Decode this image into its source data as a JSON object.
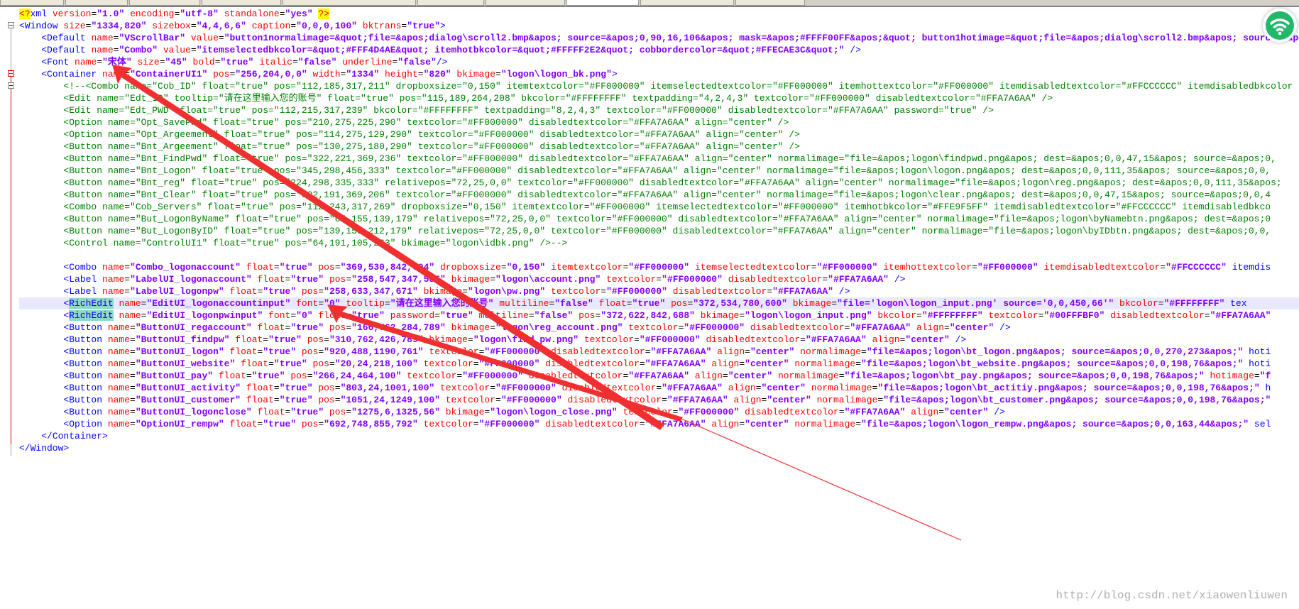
{
  "editor": {
    "language": "xml",
    "highlighted_line": 25,
    "lines": [
      "<?xml version=\"1.0\" encoding=\"utf-8\" standalone=\"yes\" ?>",
      "<Window size=\"1334,820\" sizebox=\"4,4,6,6\" caption=\"0,0,0,100\" bktrans=\"true\">",
      "    <Default name=\"VScrollBar\" value=\"button1normalimage=&quot;file=&apos;dialog\\scroll2.bmp&apos; source=&apos;0,90,16,106&apos; mask=&apos;#FFFF00FF&apos;&quot; button1hotimage=&quot;file=&apos;dialog\\scroll2.bmp&apos; source=&apos;",
      "    <Default name=\"Combo\" value=\"itemselectedbkcolor=&quot;#FFF4D4AE&quot; itemhotbkcolor=&quot;#FFFFF2E2&quot; cobbordercolor=&quot;#FFECAE3C&quot;\" />",
      "    <Font name=\"宋体\" size=\"45\" bold=\"true\" italic=\"false\" underline=\"false\"/>",
      "    <Container name=\"ContainerUI1\" pos=\"256,204,0,0\" width=\"1334\" height=\"820\" bkimage=\"logon\\logon_bk.png\">",
      "        <!--<Combo name=\"Cob_ID\" float=\"true\" pos=\"112,185,317,211\" dropboxsize=\"0,150\" itemtextcolor=\"#FF000000\" itemselectedtextcolor=\"#FF000000\" itemhottextcolor=\"#FF000000\" itemdisabledtextcolor=\"#FFCCCCCC\" itemdisabledbkcolor",
      "        <Edit name=\"Edt_ID\" tooltip=\"请在这里输入您的账号\" float=\"true\" pos=\"115,189,264,208\" bkcolor=\"#FFFFFFFF\" textpadding=\"4,2,4,3\" textcolor=\"#FF000000\" disabledtextcolor=\"#FFA7A6AA\" />",
      "        <Edit name=\"Edt_PWD\" float=\"true\" pos=\"112,215,317,239\" bkcolor=\"#FFFFFFFF\" textpadding=\"8,2,4,3\" textcolor=\"#FF000000\" disabledtextcolor=\"#FFA7A6AA\" password=\"true\" />",
      "        <Option name=\"Opt_SavePwd\" float=\"true\" pos=\"210,275,225,290\" textcolor=\"#FF000000\" disabledtextcolor=\"#FFA7A6AA\" align=\"center\" />",
      "        <Option name=\"Opt_Argeement\" float=\"true\" pos=\"114,275,129,290\" textcolor=\"#FF000000\" disabledtextcolor=\"#FFA7A6AA\" align=\"center\" />",
      "        <Button name=\"Bnt_Argeement\" float=\"true\" pos=\"130,275,180,290\" textcolor=\"#FF000000\" disabledtextcolor=\"#FFA7A6AA\" align=\"center\" />",
      "        <Button name=\"Bnt_FindPwd\" float=\"true\" pos=\"322,221,369,236\" textcolor=\"#FF000000\" disabledtextcolor=\"#FFA7A6AA\" align=\"center\" normalimage=\"file=&apos;logon\\findpwd.png&apos; dest=&apos;0,0,47,15&apos; source=&apos;0,",
      "        <Button name=\"Bnt_Logon\" float=\"true\" pos=\"345,298,456,333\" textcolor=\"#FF000000\" disabledtextcolor=\"#FFA7A6AA\" align=\"center\" normalimage=\"file=&apos;logon\\logon.png&apos; dest=&apos;0,0,111,35&apos; source=&apos;0,0,",
      "        <Button name=\"Bnt_reg\" float=\"true\" pos=\"224,298,335,333\" relativepos=\"72,25,0,0\" textcolor=\"#FF000000\" disabledtextcolor=\"#FFA7A6AA\" align=\"center\" normalimage=\"file=&apos;logon\\reg.png&apos; dest=&apos;0,0,111,35&apos;",
      "        <Button name=\"Bnt_Clear\" float=\"true\" pos=\"322,191,369,206\" textcolor=\"#FF000000\" disabledtextcolor=\"#FFA7A6AA\" align=\"center\" normalimage=\"file=&apos;logon\\clear.png&apos; dest=&apos;0,0,47,15&apos; source=&apos;0,0,4",
      "        <Combo name=\"Cob_Servers\" float=\"true\" pos=\"112,243,317,269\" dropboxsize=\"0,150\" itemtextcolor=\"#FF000000\" itemselectedtextcolor=\"#FF000000\" itemhotbkcolor=\"#FFE9F5FF\" itemdisabledtextcolor=\"#FFCCCCCC\" itemdisabledbkco",
      "        <Button name=\"But_LogonByName\" float=\"true\" pos=\"65,155,139,179\" relativepos=\"72,25,0,0\" textcolor=\"#FF000000\" disabledtextcolor=\"#FFA7A6AA\" align=\"center\" normalimage=\"file=&apos;logon\\byNamebtn.png&apos; dest=&apos;0",
      "        <Button name=\"But_LogonByID\" float=\"true\" pos=\"139,155,212,179\" relativepos=\"72,25,0,0\" textcolor=\"#FF000000\" disabledtextcolor=\"#FFA7A6AA\" align=\"center\" normalimage=\"file=&apos;logon\\byIDbtn.png&apos; dest=&apos;0,0,",
      "        <Control name=\"ControlUI1\" float=\"true\" pos=\"64,191,105,263\" bkimage=\"logon\\idbk.png\" />-->",
      "",
      "        <Combo name=\"Combo_logonaccount\" float=\"true\" pos=\"369,530,842,604\" dropboxsize=\"0,150\" itemtextcolor=\"#FF000000\" itemselectedtextcolor=\"#FF000000\" itemhottextcolor=\"#FF000000\" itemdisabledtextcolor=\"#FFCCCCCC\" itemdis",
      "        <Label name=\"LabelUI_logonaccount\" float=\"true\" pos=\"258,547,347,585\" bkimage=\"logon\\account.png\" textcolor=\"#FF000000\" disabledtextcolor=\"#FFA7A6AA\" />",
      "        <Label name=\"LabelUI_logonpw\" float=\"true\" pos=\"258,633,347,671\" bkimage=\"logon\\pw.png\" textcolor=\"#FF000000\" disabledtextcolor=\"#FFA7A6AA\" />",
      "        <RichEdit name=\"EditUI_logonaccountinput\" font=\"0\" tooltip=\"请在这里输入您的账号\" multiline=\"false\" float=\"true\" pos=\"372,534,780,600\" bkimage=\"file='logon\\logon_input.png' source='0,0,450,66'\" bkcolor=\"#FFFFFFFF\" tex",
      "        <RichEdit name=\"EditUI_logonpwinput\" font=\"0\" float=\"true\" password=\"true\" multiline=\"false\" pos=\"372,622,842,688\" bkimage=\"logon\\logon_input.png\" bkcolor=\"#FFFFFFFF\" textcolor=\"#00FFFBF0\" disabledtextcolor=\"#FFA7A6AA\"",
      "        <Button name=\"ButtonUI_regaccount\" float=\"true\" pos=\"166,762,284,789\" bkimage=\"logon\\reg_account.png\" textcolor=\"#FF000000\" disabledtextcolor=\"#FFA7A6AA\" align=\"center\" />",
      "        <Button name=\"ButtonUI_findpw\" float=\"true\" pos=\"310,762,426,789\" bkimage=\"logon\\find_pw.png\" textcolor=\"#FF000000\" disabledtextcolor=\"#FFA7A6AA\" align=\"center\" />",
      "        <Button name=\"ButtonUI_logon\" float=\"true\" pos=\"920,488,1190,761\" textcolor=\"#FF000000\" disabledtextcolor=\"#FFA7A6AA\" align=\"center\" normalimage=\"file=&apos;logon\\bt_logon.png&apos; source=&apos;0,0,270,273&apos;\" hoti",
      "        <Button name=\"ButtonUI_website\" float=\"true\" pos=\"20,24,218,100\" textcolor=\"#FF000000\" disabledtextcolor=\"#FFA7A6AA\" align=\"center\" normalimage=\"file=&apos;logon\\bt_website.png&apos; source=&apos;0,0,198,76&apos;\" hoti",
      "        <Button name=\"ButtonUI_pay\" float=\"true\" pos=\"266,24,464,100\" textcolor=\"#FF000000\" disabledtextcolor=\"#FFA7A6AA\" align=\"center\" normalimage=\"file=&apos;logon\\bt_pay.png&apos; source=&apos;0,0,198,76&apos;\" hotimage=\"f",
      "        <Button name=\"ButtonUI_activity\" float=\"true\" pos=\"803,24,1001,100\" textcolor=\"#FF000000\" disabledtextcolor=\"#FFA7A6AA\" align=\"center\" normalimage=\"file=&apos;logon\\bt_actitiy.png&apos; source=&apos;0,0,198,76&apos;\" h",
      "        <Button name=\"ButtonUI_customer\" float=\"true\" pos=\"1051,24,1249,100\" textcolor=\"#FF000000\" disabledtextcolor=\"#FFA7A6AA\" align=\"center\" normalimage=\"file=&apos;logon\\bt_customer.png&apos; source=&apos;0,0,198,76&apos;\"",
      "        <Button name=\"ButtonUI_logonclose\" float=\"true\" pos=\"1275,6,1325,56\" bkimage=\"logon\\logon_close.png\" textcolor=\"#FF000000\" disabledtextcolor=\"#FFA7A6AA\" align=\"center\" />",
      "        <Option name=\"OptionUI_rempw\" float=\"true\" pos=\"692,748,855,792\" textcolor=\"#FF000000\" disabledtextcolor=\"#FFA7A6AA\" align=\"center\" normalimage=\"file=&apos;logon\\logon_rempw.png&apos; source=&apos;0,0,163,44&apos;\" sel",
      "    </Container>",
      "</Window>"
    ]
  },
  "colors": {
    "tag": "#0000FF",
    "attribute": "#FF0000",
    "value": "#8000FF",
    "comment": "#008000",
    "annotation_arrow": "#F03030",
    "wifi_badge": "#22B86A"
  },
  "icons": {
    "wifi": "wifi-icon"
  },
  "watermark": "http://blog.csdn.net/xiaowenliuwen"
}
